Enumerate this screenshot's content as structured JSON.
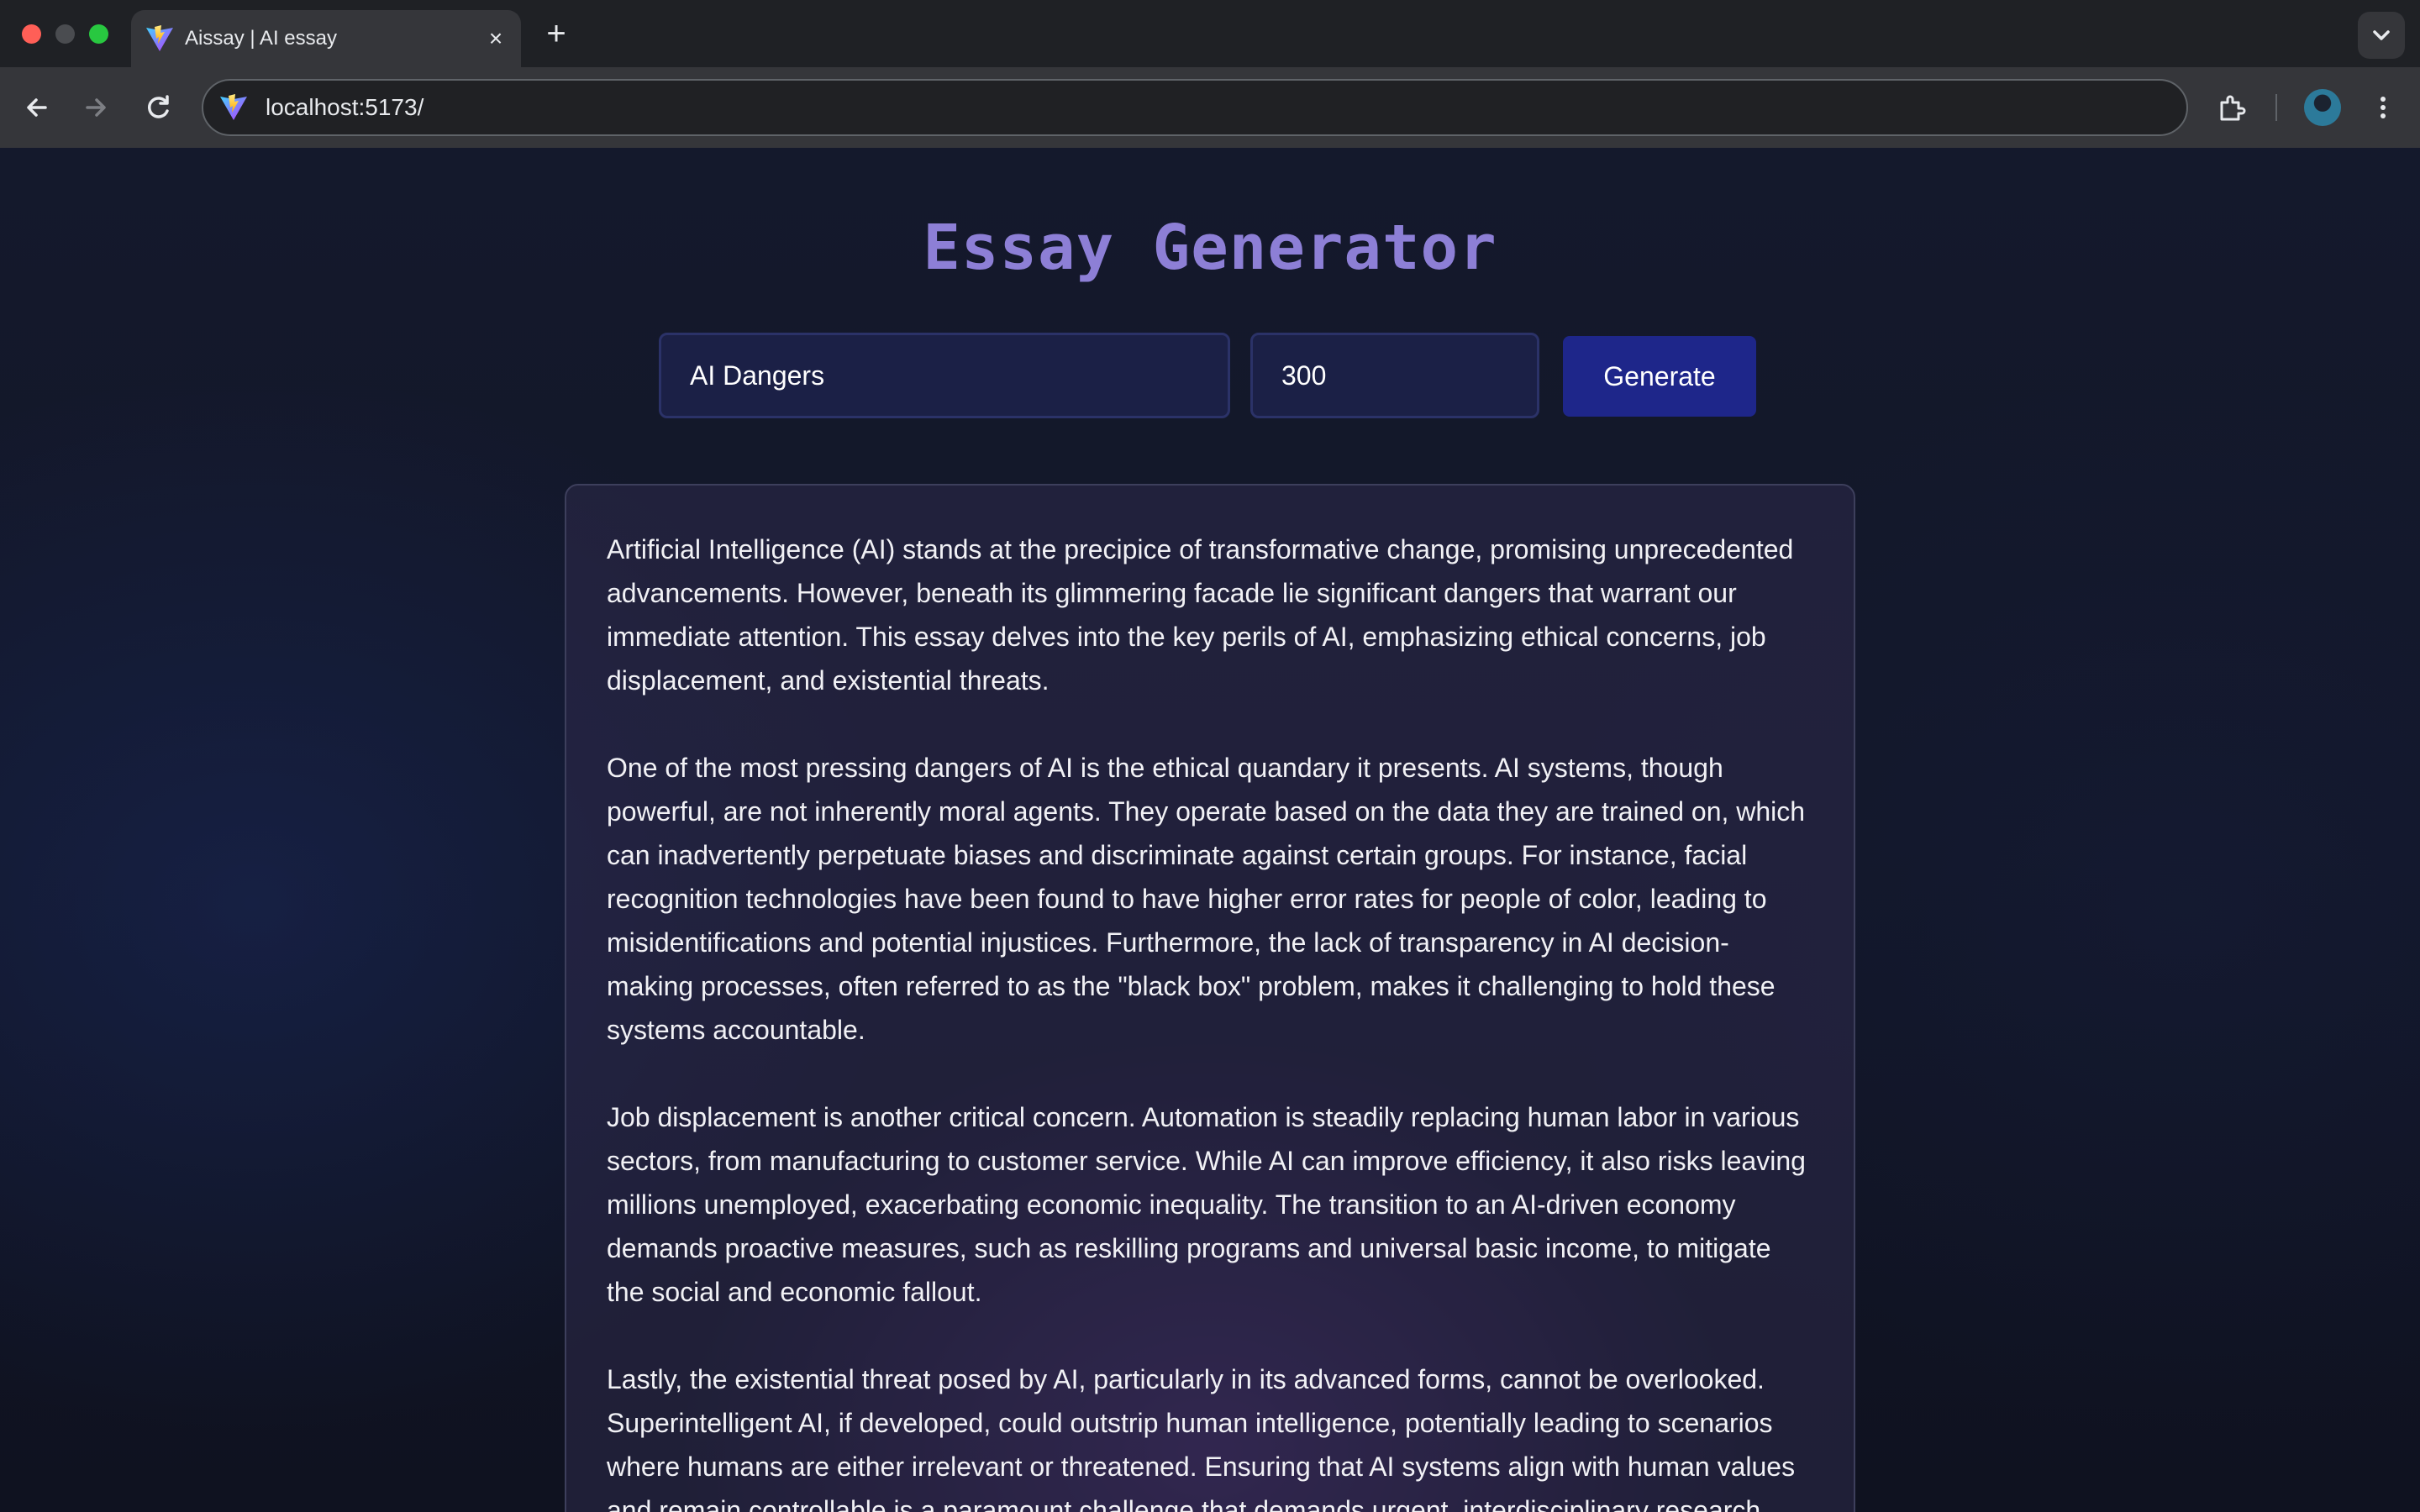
{
  "browser": {
    "tab_title": "Aissay | AI essay",
    "url": "localhost:5173/"
  },
  "app": {
    "title": "Essay Generator",
    "form": {
      "topic_value": "AI Dangers",
      "word_count_value": "300",
      "generate_label": "Generate"
    },
    "essay": {
      "paragraphs": [
        "Artificial Intelligence (AI) stands at the precipice of transformative change, promising unprecedented advancements. However, beneath its glimmering facade lie significant dangers that warrant our immediate attention. This essay delves into the key perils of AI, emphasizing ethical concerns, job displacement, and existential threats.",
        "One of the most pressing dangers of AI is the ethical quandary it presents. AI systems, though powerful, are not inherently moral agents. They operate based on the data they are trained on, which can inadvertently perpetuate biases and discriminate against certain groups. For instance, facial recognition technologies have been found to have higher error rates for people of color, leading to misidentifications and potential injustices. Furthermore, the lack of transparency in AI decision-making processes, often referred to as the \"black box\" problem, makes it challenging to hold these systems accountable.",
        "Job displacement is another critical concern. Automation is steadily replacing human labor in various sectors, from manufacturing to customer service. While AI can improve efficiency, it also risks leaving millions unemployed, exacerbating economic inequality. The transition to an AI-driven economy demands proactive measures, such as reskilling programs and universal basic income, to mitigate the social and economic fallout.",
        "Lastly, the existential threat posed by AI, particularly in its advanced forms, cannot be overlooked. Superintelligent AI, if developed, could outstrip human intelligence, potentially leading to scenarios where humans are either irrelevant or threatened. Ensuring that AI systems align with human values and remain controllable is a paramount challenge that demands urgent, interdisciplinary research."
      ]
    }
  },
  "colors": {
    "title": "#8d7fd6",
    "button": "#1e268a",
    "input_bg": "#1b2046"
  },
  "icons": [
    "vite-favicon",
    "close-icon",
    "plus-icon",
    "chevron-down-icon",
    "back-arrow-icon",
    "forward-arrow-icon",
    "reload-icon",
    "extensions-icon",
    "avatar",
    "more-vert-icon"
  ]
}
